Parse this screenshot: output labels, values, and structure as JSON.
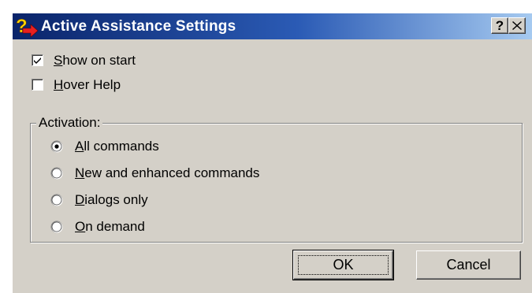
{
  "window": {
    "title": "Active Assistance Settings",
    "help_button": "?",
    "close_button": "✕"
  },
  "options": {
    "show_on_start": {
      "label_u": "S",
      "label_rest": "how on start",
      "checked": true
    },
    "hover_help": {
      "label_u": "H",
      "label_rest": "over Help",
      "checked": false
    }
  },
  "activation": {
    "legend": "Activation:",
    "items": [
      {
        "label_u": "A",
        "label_rest": "ll commands",
        "selected": true
      },
      {
        "label_u": "N",
        "label_rest": "ew and enhanced commands",
        "selected": false
      },
      {
        "label_u": "D",
        "label_rest": "ialogs only",
        "selected": false
      },
      {
        "label_u": "O",
        "label_rest": "n demand",
        "selected": false
      }
    ]
  },
  "buttons": {
    "ok": "OK",
    "cancel": "Cancel"
  },
  "colors": {
    "titlebar_start": "#0a246a",
    "titlebar_end": "#a6caf0",
    "face": "#d4d0c8"
  }
}
